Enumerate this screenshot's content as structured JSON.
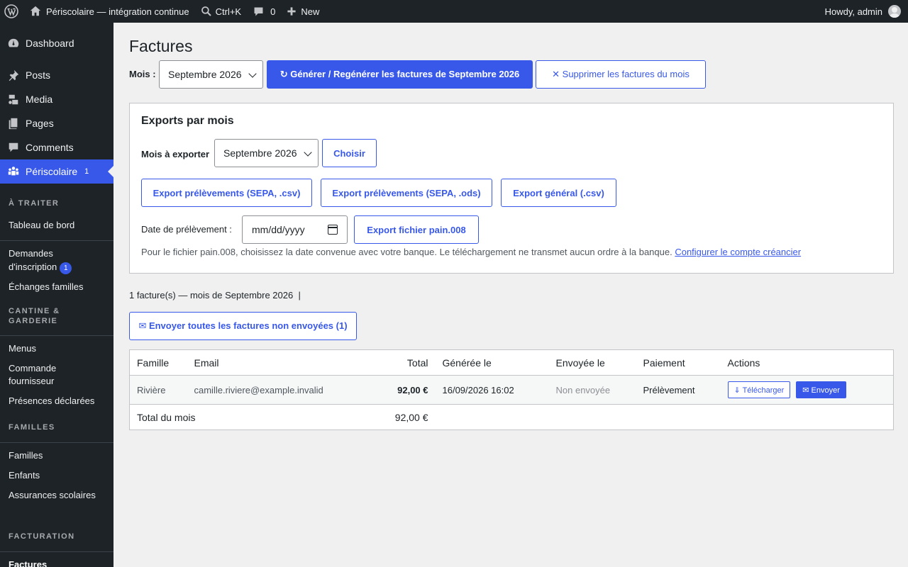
{
  "adminbar": {
    "site_name": "Périscolaire — intégration continue",
    "search_label": "Ctrl+K",
    "comments_count": "0",
    "new_label": "New",
    "howdy": "Howdy, admin"
  },
  "sidebar": {
    "dashboard": "Dashboard",
    "posts": "Posts",
    "media": "Media",
    "pages": "Pages",
    "comments": "Comments",
    "periscolaire": "Périscolaire",
    "periscolaire_count": "1",
    "section_a_traiter": "À TRAITER",
    "tableau_de_bord": "Tableau de bord",
    "demandes_line1": "Demandes",
    "demandes_line2": "d'inscription",
    "demandes_badge": "1",
    "echanges_familles": "Échanges familles",
    "section_cantine_1": "CANTINE &",
    "section_cantine_2": "GARDERIE",
    "menus": "Menus",
    "commande_line1": "Commande",
    "commande_line2": "fournisseur",
    "presences": "Présences déclarées",
    "section_familles": "FAMILLES",
    "familles": "Familles",
    "enfants": "Enfants",
    "assurances": "Assurances scolaires",
    "section_facturation": "FACTURATION",
    "factures": "Factures"
  },
  "main": {
    "title": "Factures",
    "mois_label": "Mois :",
    "mois_value": "Septembre 2026",
    "generate_button": "↻ Générer / Regénérer les factures de Septembre 2026",
    "delete_button": "✕ Supprimer les factures du mois",
    "exports": {
      "title": "Exports par mois",
      "mois_label": "Mois à exporter",
      "mois_value": "Septembre 2026",
      "choose_button": "Choisir",
      "export_sepa_csv": "Export prélèvements (SEPA, .csv)",
      "export_sepa_ods": "Export prélèvements (SEPA, .ods)",
      "export_general": "Export général (.csv)",
      "date_label": "Date de prélèvement :",
      "date_placeholder": "mm/dd/yyyy",
      "export_pain": "Export fichier pain.008",
      "help_text": "Pour le fichier pain.008, choisissez la date convenue avec votre banque. Le téléchargement ne transmet aucun ordre à la banque.",
      "help_link": "Configurer le compte créancier"
    },
    "count_line": "1 facture(s) — mois de Septembre 2026  |",
    "send_all_button": "✉ Envoyer toutes les factures non envoyées (1)",
    "table": {
      "headers": [
        "Famille",
        "Email",
        "Total",
        "Générée le",
        "Envoyée le",
        "Paiement",
        "Actions"
      ],
      "rows": [
        {
          "famille": "Rivière",
          "email": "camille.riviere@example.invalid",
          "total": "92,00 €",
          "generee": "16/09/2026 16:02",
          "envoyee": "Non envoyée",
          "paiement": "Prélèvement",
          "download": "⇓ Télécharger",
          "send": "✉ Envoyer"
        }
      ],
      "footer_label": "Total du mois",
      "footer_total": "92,00 €"
    }
  }
}
